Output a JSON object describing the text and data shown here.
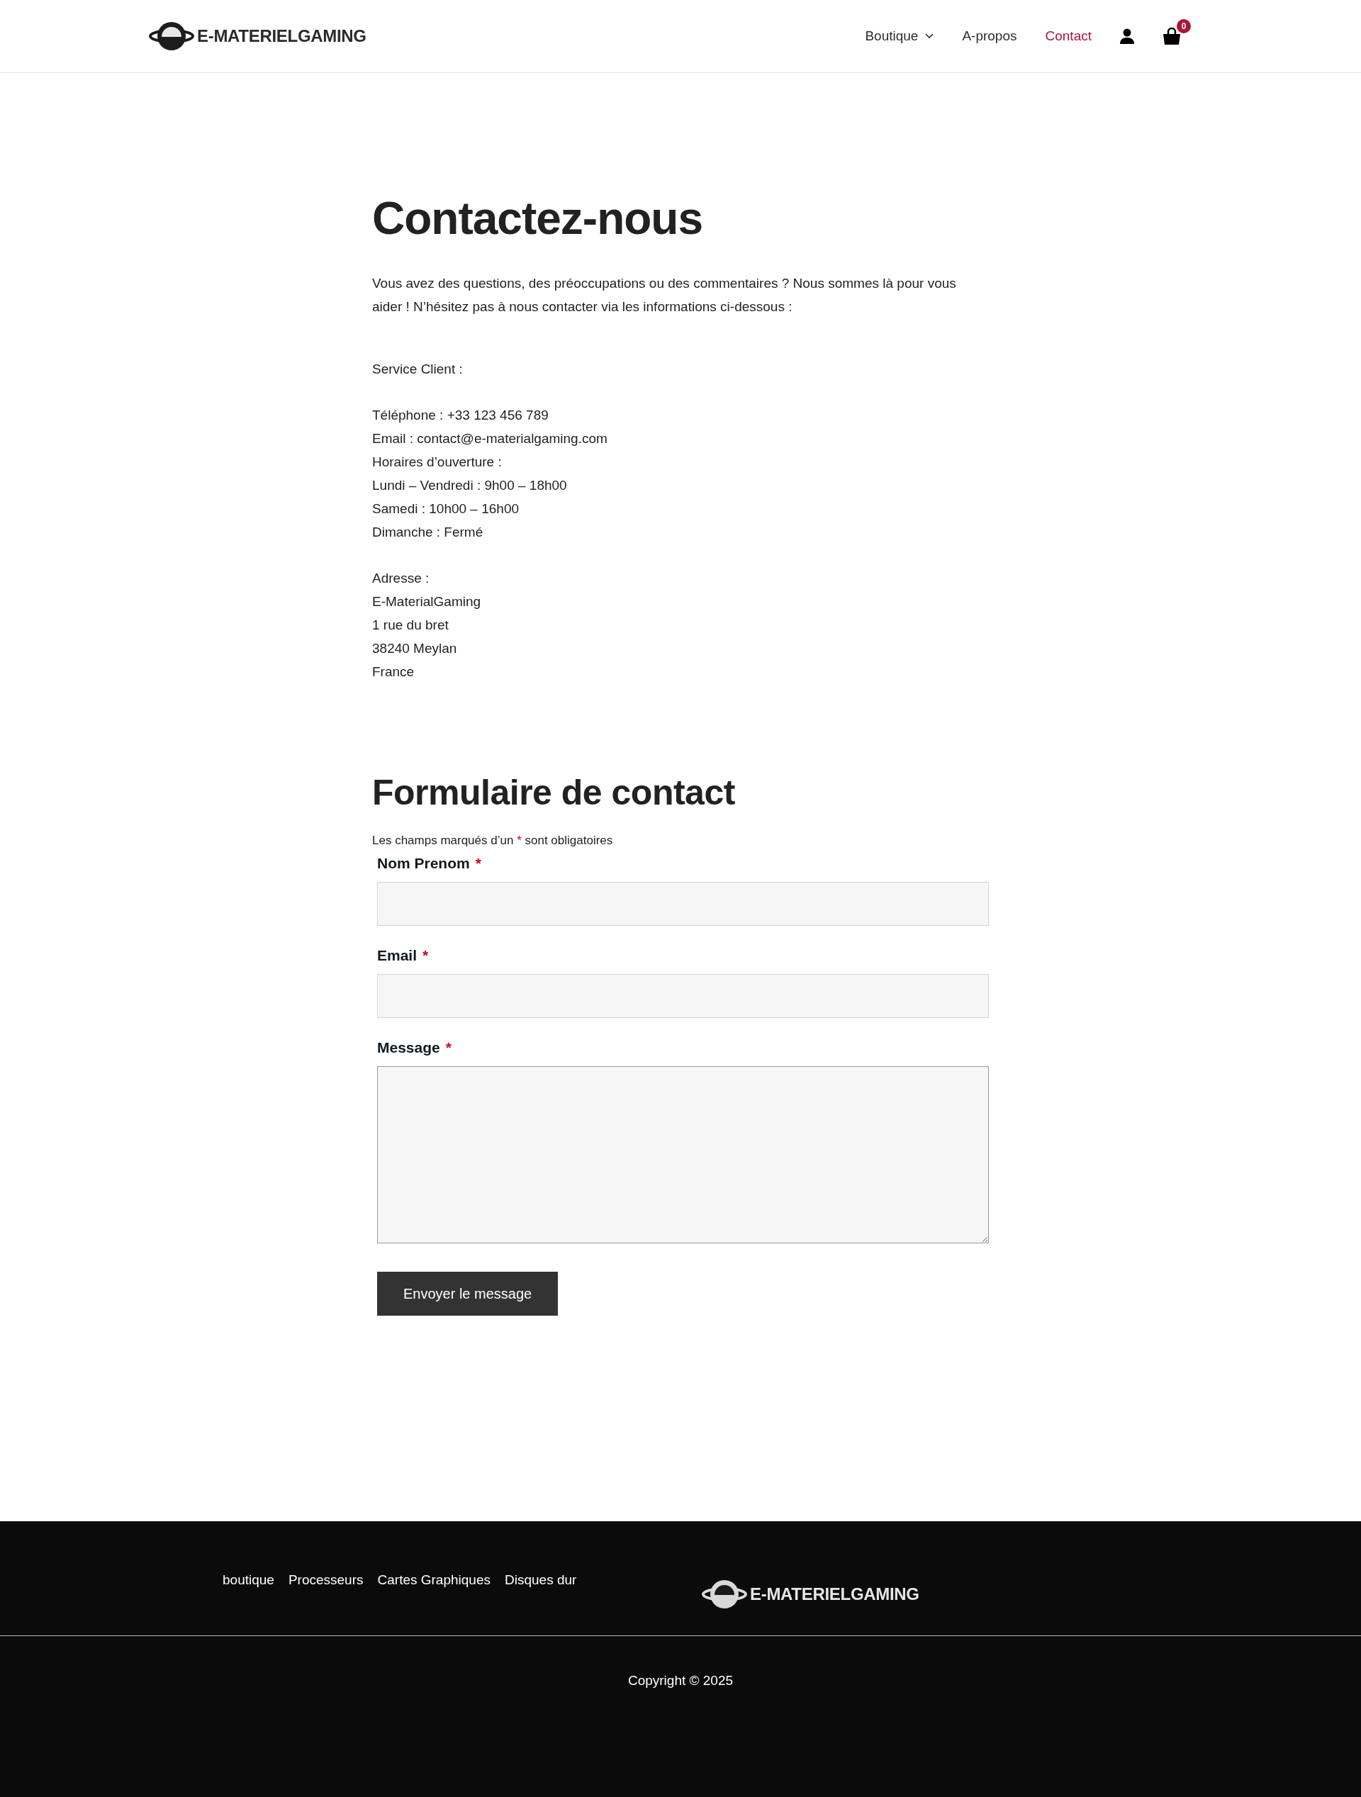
{
  "header": {
    "logo_text": "E-MATERIELGAMING",
    "nav": [
      {
        "label": "Boutique",
        "has_dropdown": true,
        "selected": false
      },
      {
        "label": "A-propos",
        "has_dropdown": false,
        "selected": false
      },
      {
        "label": "Contact",
        "has_dropdown": false,
        "selected": true
      }
    ],
    "cart_count": "0"
  },
  "content": {
    "title": "Contactez-nous",
    "intro": "Vous avez des questions, des préoccupations ou des commentaires ? Nous sommes là pour vous aider ! N’hésitez pas à nous contacter via les informations ci-dessous :",
    "info_blocks": [
      {
        "lines": [
          "Service Client :"
        ]
      },
      {
        "lines": [
          "Téléphone : +33 123 456 789",
          "Email : contact@e-materialgaming.com",
          "Horaires d’ouverture :",
          "Lundi – Vendredi : 9h00 – 18h00",
          "Samedi : 10h00 – 16h00",
          "Dimanche : Fermé"
        ]
      },
      {
        "lines": [
          "Adresse :",
          "E-MaterialGaming",
          "1 rue du bret",
          "38240 Meylan",
          "France"
        ]
      }
    ]
  },
  "form": {
    "title": "Formulaire de contact",
    "notice": {
      "before": "Les champs marqués d’un",
      "mark": "*",
      "after": "sont obligatoires"
    },
    "fields": [
      {
        "label": "Nom Prenom",
        "required": true,
        "kind": "input"
      },
      {
        "label": "Email",
        "required": true,
        "kind": "input"
      },
      {
        "label": "Message",
        "required": true,
        "kind": "textarea"
      }
    ],
    "submit": "Envoyer le message"
  },
  "footer": {
    "links": [
      "boutique",
      "Processeurs",
      "Cartes Graphiques",
      "Disques dur"
    ],
    "logo_text": "E-MATERIELGAMING",
    "copyright": "Copyright © 2025"
  }
}
